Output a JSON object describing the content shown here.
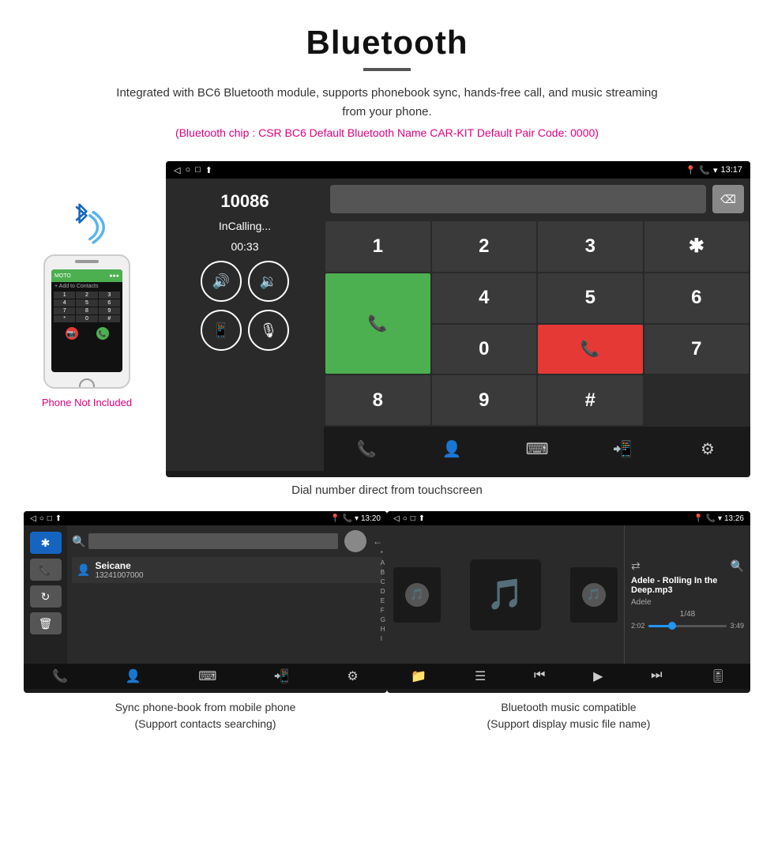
{
  "header": {
    "title": "Bluetooth",
    "subtitle": "Integrated with BC6 Bluetooth module, supports phonebook sync, hands-free call, and music streaming from your phone.",
    "specs": "(Bluetooth chip : CSR BC6    Default Bluetooth Name CAR-KIT    Default Pair Code: 0000)"
  },
  "phone_section": {
    "not_included_label": "Phone Not Included"
  },
  "car_screen": {
    "status_bar": {
      "back": "◁",
      "circle": "○",
      "square": "□",
      "upload": "⬆",
      "location": "▾",
      "phone": "📞",
      "signal": "▾",
      "time": "13:17"
    },
    "caller": {
      "number": "10086",
      "status": "InCalling...",
      "duration": "00:33"
    },
    "keypad": {
      "keys": [
        "1",
        "2",
        "3",
        "*",
        "4",
        "5",
        "6",
        "0",
        "7",
        "8",
        "9",
        "#"
      ]
    }
  },
  "dial_caption": "Dial number direct from touchscreen",
  "phonebook_screen": {
    "status_time": "13:20",
    "contact_name": "Seicane",
    "contact_number": "13241007000",
    "alphabet": [
      "*",
      "A",
      "B",
      "C",
      "D",
      "E",
      "F",
      "G",
      "H",
      "I"
    ]
  },
  "phonebook_caption_line1": "Sync phone-book from mobile phone",
  "phonebook_caption_line2": "(Support contacts searching)",
  "music_screen": {
    "status_time": "13:26",
    "track_name": "Adele - Rolling In the Deep.mp3",
    "artist": "Adele",
    "count": "1/48",
    "time_current": "2:02",
    "time_total": "3:49"
  },
  "music_caption_line1": "Bluetooth music compatible",
  "music_caption_line2": "(Support display music file name)"
}
